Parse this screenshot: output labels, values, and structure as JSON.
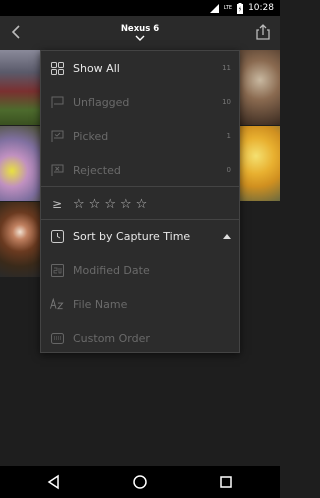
{
  "status_bar": {
    "time": "10:28",
    "network_label": "LTE"
  },
  "app_bar": {
    "title": "Nexus 6"
  },
  "menu": {
    "filters": [
      {
        "label": "Show All",
        "count": "11",
        "icon": "grid-icon",
        "active": true
      },
      {
        "label": "Unflagged",
        "count": "10",
        "icon": "unflagged-icon",
        "active": false
      },
      {
        "label": "Picked",
        "count": "1",
        "icon": "flag-picked-icon",
        "active": false
      },
      {
        "label": "Rejected",
        "count": "0",
        "icon": "flag-rejected-icon",
        "active": false
      }
    ],
    "rating_filter": {
      "operator": "≥",
      "stars": [
        "☆",
        "☆",
        "☆",
        "☆",
        "☆"
      ]
    },
    "sort": [
      {
        "label": "Sort by Capture Time",
        "icon": "clock-icon",
        "active": true
      },
      {
        "label": "Modified Date",
        "icon": "calendar-icon",
        "active": false
      },
      {
        "label": "File Name",
        "icon": "az-icon",
        "active": false
      },
      {
        "label": "Custom Order",
        "icon": "keyboard-icon",
        "active": false
      }
    ]
  },
  "colors": {
    "background": "#1e1e1e",
    "app_bar": "#2a2a2a",
    "menu_bg": "#2c2c2c",
    "active_text": "#e8e8e8",
    "dim_text": "#6a6a6a"
  }
}
